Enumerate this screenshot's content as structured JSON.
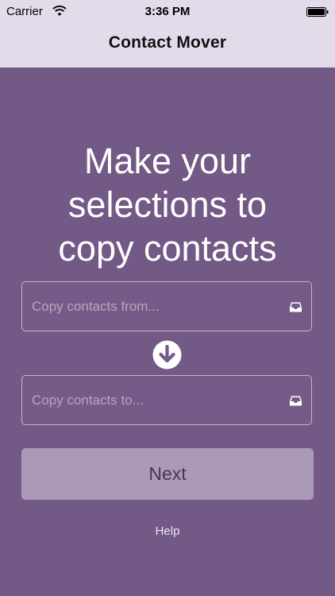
{
  "status_bar": {
    "carrier": "Carrier",
    "time": "3:36 PM",
    "wifi_icon": "wifi-icon",
    "battery_icon": "battery-icon"
  },
  "nav": {
    "title": "Contact Mover"
  },
  "main": {
    "headline_line1": "Make your",
    "headline_line2": "selections to",
    "headline_line3": "copy contacts",
    "from_field": {
      "placeholder": "Copy contacts from...",
      "icon": "tray-icon"
    },
    "arrow_icon": "arrow-down-circle-icon",
    "to_field": {
      "placeholder": "Copy contacts to...",
      "icon": "tray-icon"
    },
    "next_label": "Next",
    "help_label": "Help"
  },
  "colors": {
    "background": "#735986",
    "nav_background": "#e3dbe9",
    "button_background": "#ab9ab7",
    "button_text": "#493558",
    "text_light": "#ffffff"
  }
}
